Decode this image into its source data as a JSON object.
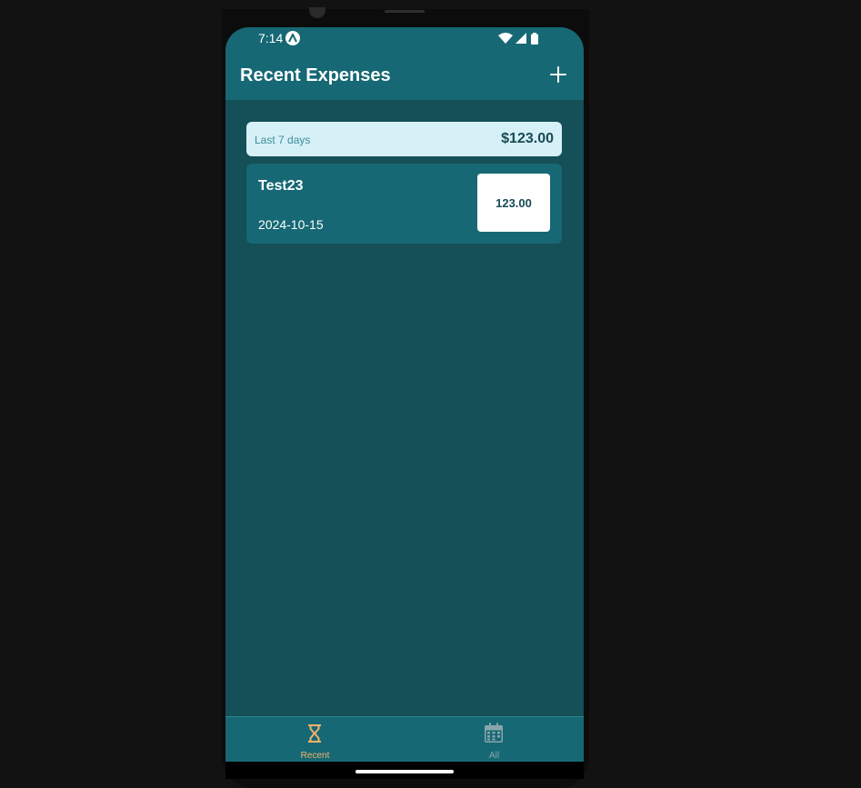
{
  "status_bar": {
    "time": "7:14"
  },
  "header": {
    "title": "Recent Expenses",
    "add_icon": "plus-icon"
  },
  "summary": {
    "period": "Last 7 days",
    "sum": "$123.00"
  },
  "expenses": [
    {
      "description": "Test23",
      "date": "2024-10-15",
      "amount": "123.00"
    }
  ],
  "bottom_nav": {
    "tabs": [
      {
        "label": "Recent",
        "icon": "hourglass-icon",
        "active": true
      },
      {
        "label": "All",
        "icon": "calendar-icon",
        "active": false
      }
    ]
  },
  "colors": {
    "header_bg": "#166874",
    "screen_bg": "#154f58",
    "summary_bg": "#d6f0f7",
    "accent_active": "#f6b26b",
    "inactive": "#8aa6ab"
  }
}
